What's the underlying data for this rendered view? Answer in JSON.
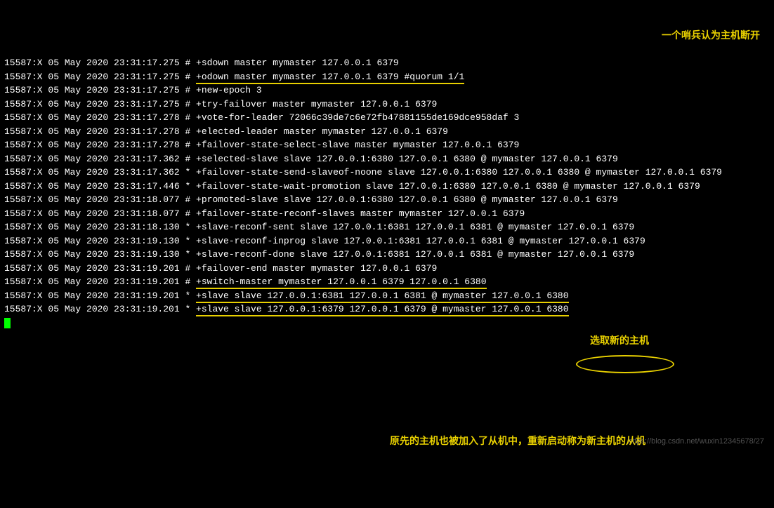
{
  "lines": [
    {
      "text": "15587:X 05 May 2020 23:31:17.275 # +sdown master mymaster 127.0.0.1 6379"
    },
    {
      "prefix": "15587:X 05 May 2020 23:31:17.275 # ",
      "ul": "+odown master mymaster 127.0.0.1 6379 #quorum 1/1"
    },
    {
      "text": "15587:X 05 May 2020 23:31:17.275 # +new-epoch 3"
    },
    {
      "text": "15587:X 05 May 2020 23:31:17.275 # +try-failover master mymaster 127.0.0.1 6379"
    },
    {
      "text": "15587:X 05 May 2020 23:31:17.278 # +vote-for-leader 72066c39de7c6e72fb47881155de169dce958daf 3"
    },
    {
      "text": "15587:X 05 May 2020 23:31:17.278 # +elected-leader master mymaster 127.0.0.1 6379"
    },
    {
      "text": "15587:X 05 May 2020 23:31:17.278 # +failover-state-select-slave master mymaster 127.0.0.1 6379"
    },
    {
      "text": "15587:X 05 May 2020 23:31:17.362 # +selected-slave slave 127.0.0.1:6380 127.0.0.1 6380 @ mymaster 127.0.0.1 6379"
    },
    {
      "text": "15587:X 05 May 2020 23:31:17.362 * +failover-state-send-slaveof-noone slave 127.0.0.1:6380 127.0.0.1 6380 @ mymaster 127.0.0.1 6379"
    },
    {
      "text": "15587:X 05 May 2020 23:31:17.446 * +failover-state-wait-promotion slave 127.0.0.1:6380 127.0.0.1 6380 @ mymaster 127.0.0.1 6379"
    },
    {
      "text": "15587:X 05 May 2020 23:31:18.077 # +promoted-slave slave 127.0.0.1:6380 127.0.0.1 6380 @ mymaster 127.0.0.1 6379"
    },
    {
      "text": "15587:X 05 May 2020 23:31:18.077 # +failover-state-reconf-slaves master mymaster 127.0.0.1 6379"
    },
    {
      "text": "15587:X 05 May 2020 23:31:18.130 * +slave-reconf-sent slave 127.0.0.1:6381 127.0.0.1 6381 @ mymaster 127.0.0.1 6379"
    },
    {
      "text": "15587:X 05 May 2020 23:31:19.130 * +slave-reconf-inprog slave 127.0.0.1:6381 127.0.0.1 6381 @ mymaster 127.0.0.1 6379"
    },
    {
      "text": "15587:X 05 May 2020 23:31:19.130 * +slave-reconf-done slave 127.0.0.1:6381 127.0.0.1 6381 @ mymaster 127.0.0.1 6379"
    },
    {
      "text": "15587:X 05 May 2020 23:31:19.201 # +failover-end master mymaster 127.0.0.1 6379"
    },
    {
      "prefix": "15587:X 05 May 2020 23:31:19.201 # ",
      "ul": "+switch-master mymaster 127.0.0.1 6379 127.0.0.1 6380"
    },
    {
      "prefix": "15587:X 05 May 2020 23:31:19.201 * ",
      "ul": "+slave slave 127.0.0.1:6381 127.0.0.1 6381 @ mymaster 127.0.0.1 6380"
    },
    {
      "prefix": "15587:X 05 May 2020 23:31:19.201 * ",
      "ul": "+slave slave 127.0.0.1:6379 127.0.0.1 6379 @ mymaster 127.0.0.1 6380"
    }
  ],
  "annotations": {
    "a1": "一个哨兵认为主机断开",
    "a2": "选取新的主机",
    "a3": "原先的主机也被加入了从机中，重新启动称为新主机的从机"
  },
  "watermark": "https://blog.csdn.net/wuxin12345678/27"
}
